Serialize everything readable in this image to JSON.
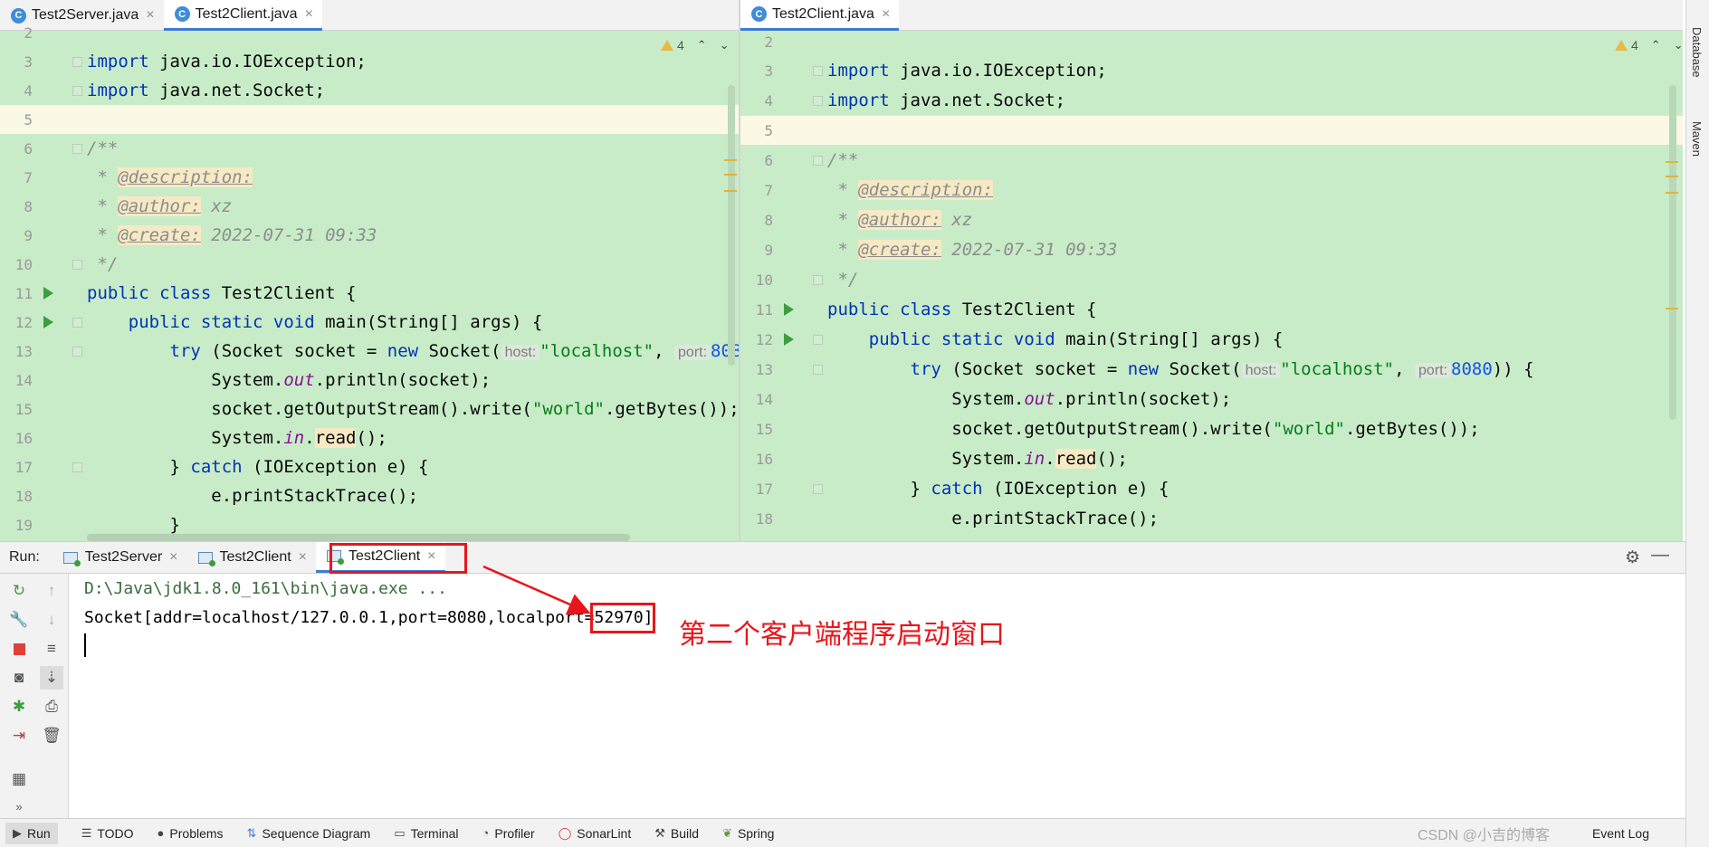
{
  "left_editor": {
    "tabs": [
      {
        "label": "Test2Server.java",
        "icon": "java-class-icon",
        "active": false
      },
      {
        "label": "Test2Client.java",
        "icon": "java-class-icon",
        "active": true
      }
    ],
    "warning_count": "4"
  },
  "right_editor": {
    "tabs": [
      {
        "label": "Test2Client.java",
        "icon": "java-class-icon",
        "active": true
      }
    ],
    "warning_count": "4"
  },
  "code": {
    "line_numbers": [
      "2",
      "3",
      "4",
      "5",
      "6",
      "7",
      "8",
      "9",
      "10",
      "11",
      "12",
      "13",
      "14",
      "15",
      "16",
      "17",
      "18",
      "19"
    ],
    "import1_kw": "import",
    "import1_rest": " java.io.IOException;",
    "import2_kw": "import",
    "import2_rest": " java.net.Socket;",
    "doc_open": "/**",
    "doc_star": " * ",
    "tag_description": "@description:",
    "tag_author": "@author:",
    "author_value": " xz",
    "tag_create": "@create:",
    "create_value": " 2022-07-31 09:33",
    "doc_close": " */",
    "class_kw": "public class",
    "class_name": " Test2Client {",
    "main_indent": "    ",
    "main_kw": "public static void",
    "main_rest": " main(String[] args) {",
    "try_indent": "        ",
    "try_kw": "try",
    "try_mid": " (Socket socket = ",
    "new_kw": "new",
    "socket_call": " Socket(",
    "hint_host": "host:",
    "str_localhost": "\"localhost\"",
    "comma": ", ",
    "hint_port": "port:",
    "num_port": "8080",
    "try_end": ")) {",
    "println_pre": "            System.",
    "out_field": "out",
    "println_post": ".println(socket);",
    "write_pre": "            socket.getOutputStream().write(",
    "str_world": "\"world\"",
    "write_post": ".getBytes());",
    "read_pre": "            System.",
    "in_field": "in",
    "read_dot": ".",
    "read_method": "read",
    "read_post": "();",
    "catch_pre": "        } ",
    "catch_kw": "catch",
    "catch_post": " (IOException e) {",
    "stack_line": "            e.printStackTrace();",
    "close_brace": "        }"
  },
  "run_panel": {
    "label": "Run:",
    "tabs": [
      {
        "label": "Test2Server",
        "active": false
      },
      {
        "label": "Test2Client",
        "active": false
      },
      {
        "label": "Test2Client",
        "active": true
      }
    ],
    "console": {
      "line1": "D:\\Java\\jdk1.8.0_161\\bin\\java.exe ...",
      "line2": "Socket[addr=localhost/127.0.0.1,port=8080,localport=52970]"
    },
    "annotation": "第二个客户端程序启动窗口"
  },
  "status_bar": {
    "items": [
      {
        "label": "Run",
        "icon": "play-icon",
        "active": true
      },
      {
        "label": "TODO",
        "icon": "list-icon"
      },
      {
        "label": "Problems",
        "icon": "info-icon"
      },
      {
        "label": "Sequence Diagram",
        "icon": "sequence-diagram-icon"
      },
      {
        "label": "Terminal",
        "icon": "terminal-icon"
      },
      {
        "label": "Profiler",
        "icon": "profiler-icon"
      },
      {
        "label": "SonarLint",
        "icon": "sonarlint-icon"
      },
      {
        "label": "Build",
        "icon": "hammer-icon"
      },
      {
        "label": "Spring",
        "icon": "leaf-icon"
      }
    ],
    "watermark": "CSDN @小吉的博客",
    "event_log": "Event Log"
  },
  "side_tools": {
    "database": "Database",
    "maven": "Maven"
  },
  "colors": {
    "diff_green": "#c8ecc8",
    "current_line": "#fbf8e6",
    "keyword": "#0033b3",
    "string": "#067d17",
    "annotation_red": "#e8161a",
    "active_tab_underline": "#3d7bd6"
  }
}
